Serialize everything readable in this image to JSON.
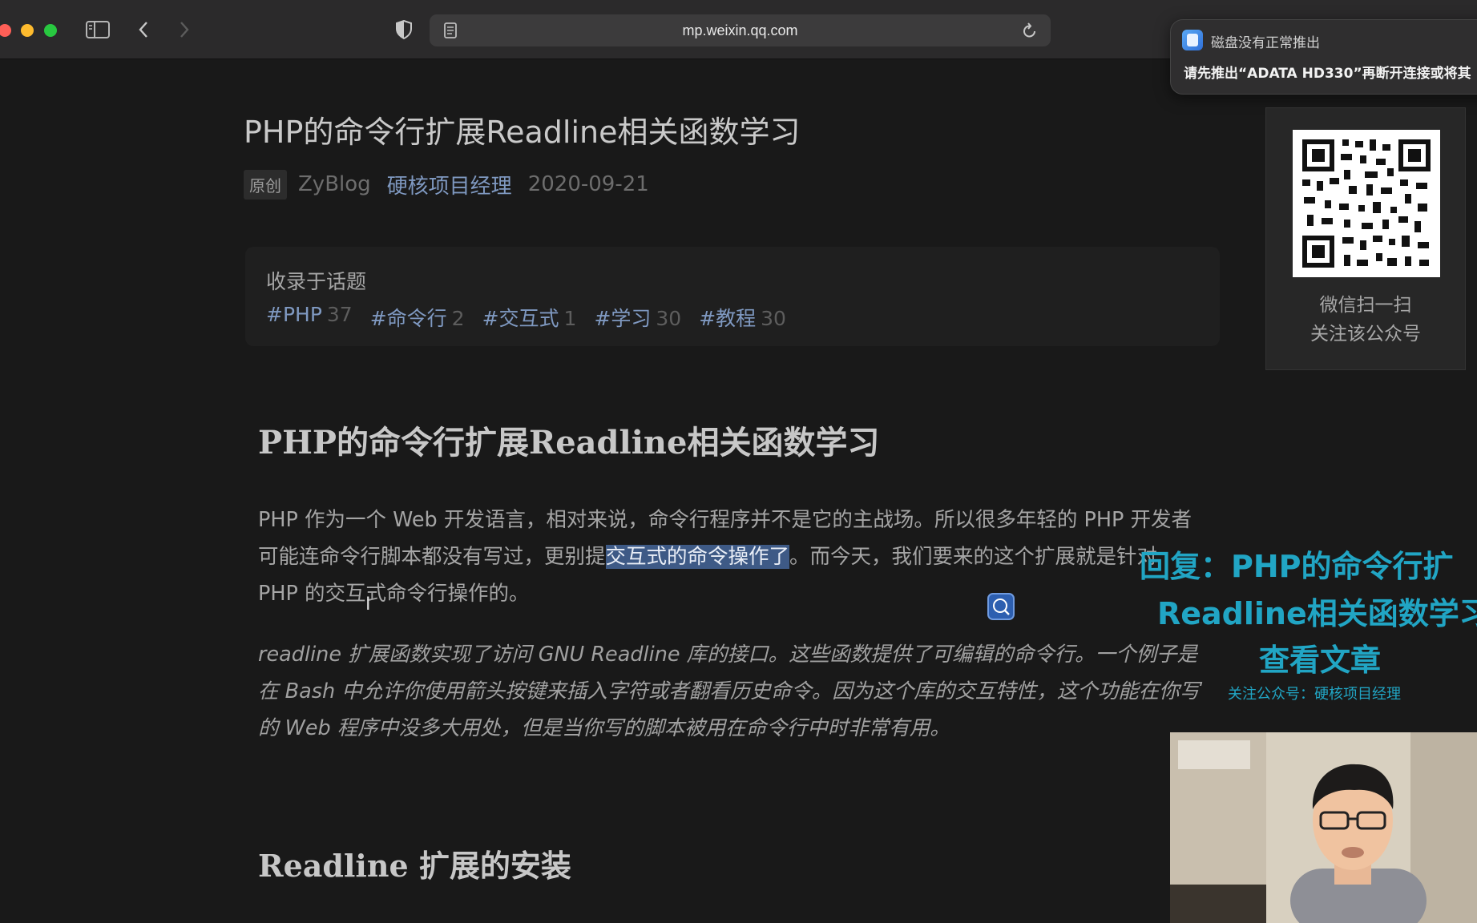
{
  "browser": {
    "url": "mp.weixin.qq.com",
    "icons": [
      "sidebar-icon",
      "back-icon",
      "forward-icon",
      "shield-icon",
      "reader-icon",
      "reload-icon"
    ]
  },
  "notification": {
    "title": "磁盘没有正常推出",
    "body": "请先推出“ADATA HD330”再断开连接或将其"
  },
  "article": {
    "title": "PHP的命令行扩展Readline相关函数学习",
    "badge": "原创",
    "author": "ZyBlog",
    "account": "硬核项目经理",
    "date": "2020-09-21",
    "topics_label": "收录于话题",
    "tags": [
      {
        "name": "#PHP",
        "count": "37"
      },
      {
        "name": "#命令行",
        "count": "2"
      },
      {
        "name": "#交互式",
        "count": "1"
      },
      {
        "name": "#学习",
        "count": "30"
      },
      {
        "name": "#教程",
        "count": "30"
      }
    ],
    "heading": "PHP的命令行扩展Readline相关函数学习",
    "para1_before": "PHP 作为一个 Web 开发语言，相对来说，命令行程序并不是它的主战场。所以很多年轻的 PHP 开发者可能连命令行脚本都没有写过，更别提",
    "para1_highlight": "交互式的命令操作了",
    "para1_after": "。而今天，我们要来的这个扩展就是针对 PHP 的交互式命令行操作的。",
    "quote": "readline 扩展函数实现了访问 GNU Readline 库的接口。这些函数提供了可编辑的命令行。一个例子是在 Bash 中允许你使用箭头按键来插入字符或者翻看历史命令。因为这个库的交互特性，这个功能在你写的 Web 程序中没多大用处，但是当你写的脚本被用在命令行中时非常有用。",
    "heading2": "Readline 扩展的安装"
  },
  "qr_card": {
    "line1": "微信扫一扫",
    "line2": "关注该公众号"
  },
  "overlay": {
    "line1": "回复：PHP的命令行扩",
    "line2": "Readline相关函数学习",
    "line3": "查看文章",
    "line4": "关注公众号：硬核项目经理"
  },
  "colors": {
    "page_bg": "#191919",
    "link": "#7f99c1",
    "highlight": "#3e5a86",
    "overlay": "#21a5c4"
  }
}
